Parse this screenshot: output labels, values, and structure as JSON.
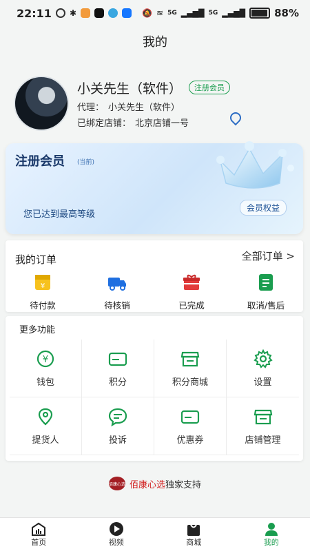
{
  "status": {
    "time": "22:11",
    "battery": "88%",
    "battery_level": 0.88,
    "net1": "5G",
    "net2": "5G"
  },
  "header": {
    "title": "我的"
  },
  "profile": {
    "name": "小关先生（软件）",
    "tag": "注册会员",
    "agent_label": "代理：",
    "agent_name": "小关先生（软件）",
    "store_label": "已绑定店铺：",
    "store_name": "北京店铺一号"
  },
  "member": {
    "title": "注册会员",
    "current": "(当前)",
    "desc": "您已达到最高等级",
    "benefit": "会员权益"
  },
  "orders": {
    "title": "我的订单",
    "all": "全部订单 >",
    "items": [
      {
        "label": "待付款",
        "icon": "wallet-yen-icon",
        "color": "#f5b400"
      },
      {
        "label": "待核销",
        "icon": "truck-icon",
        "color": "#1f6fe0"
      },
      {
        "label": "已完成",
        "icon": "gift-icon",
        "color": "#e23b3b"
      },
      {
        "label": "取消/售后",
        "icon": "list-icon",
        "color": "#1a9d4f"
      }
    ]
  },
  "more": {
    "title": "更多功能",
    "items": [
      {
        "label": "钱包",
        "icon": "yen-coin-icon"
      },
      {
        "label": "积分",
        "icon": "card-icon"
      },
      {
        "label": "积分商城",
        "icon": "store-icon"
      },
      {
        "label": "设置",
        "icon": "gear-icon"
      },
      {
        "label": "提货人",
        "icon": "location-pin-icon"
      },
      {
        "label": "投诉",
        "icon": "chat-bubble-icon"
      },
      {
        "label": "优惠券",
        "icon": "coupon-icon"
      },
      {
        "label": "店铺管理",
        "icon": "store-manage-icon"
      }
    ]
  },
  "brand": {
    "logo": "佰康心选",
    "name": "佰康心选",
    "text": "独家支持"
  },
  "tabs": [
    {
      "label": "首页",
      "icon": "home-chart-icon",
      "active": false
    },
    {
      "label": "视频",
      "icon": "play-icon",
      "active": false
    },
    {
      "label": "商城",
      "icon": "bag-icon",
      "active": false
    },
    {
      "label": "我的",
      "icon": "user-icon",
      "active": true
    }
  ],
  "colors": {
    "accent": "#1a9d4f",
    "member_text": "#1b3a6b",
    "brand": "#d11d1d"
  }
}
